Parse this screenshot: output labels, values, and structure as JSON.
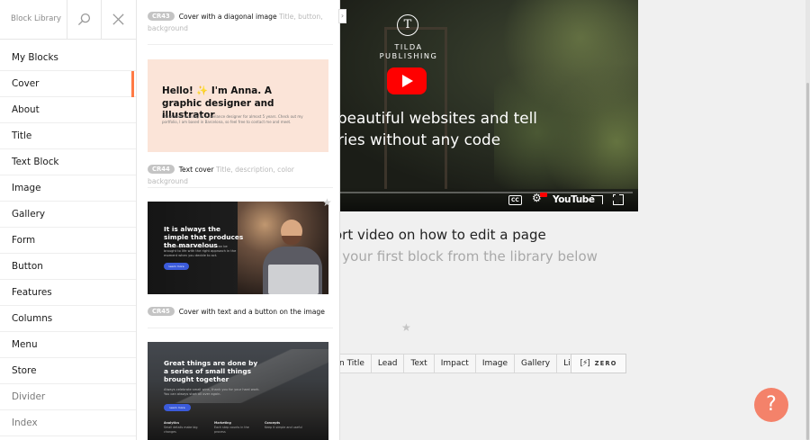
{
  "sidebar": {
    "title": "Block Library",
    "items": [
      {
        "label": "My Blocks"
      },
      {
        "label": "Cover"
      },
      {
        "label": "About"
      },
      {
        "label": "Title"
      },
      {
        "label": "Text Block"
      },
      {
        "label": "Image"
      },
      {
        "label": "Gallery"
      },
      {
        "label": "Form"
      },
      {
        "label": "Button"
      },
      {
        "label": "Features"
      },
      {
        "label": "Columns"
      },
      {
        "label": "Menu"
      },
      {
        "label": "Store"
      },
      {
        "label": "Divider"
      },
      {
        "label": "Index"
      }
    ],
    "active_item": "Cover",
    "accent_color": "#ff7a45"
  },
  "panel": {
    "blocks": [
      {
        "code": "CR43",
        "name": "Cover with a diagonal image",
        "meta": "Title, button, background"
      },
      {
        "code": "CR44",
        "name": "Text cover",
        "meta": "Title, description, color background"
      },
      {
        "code": "CR45",
        "name": "Cover with text and a button on the image",
        "meta": ""
      }
    ],
    "thumb1": {
      "heading": "Hello! ✨ I'm Anna. A graphic designer and illustrator",
      "text": "I have been working as a freelance designer for almost 5 years. Check out my portfolio, I am based in Barcelona, so feel free to contact me and meet."
    },
    "thumb2": {
      "heading": "It is always the simple that produces the marvelous",
      "text": "Everything that you dreamed of can be brought to life with the right approach in the moment when you decide to act.",
      "button": "Learn more"
    },
    "thumb3": {
      "heading": "Great things are done by a series of small things brought together",
      "text": "Always celebrate small wins, thank you for your hard work. You can always start all over again.",
      "button": "Learn more",
      "columns": [
        {
          "title": "Analytics",
          "text": "Small details make big changes"
        },
        {
          "title": "Marketing",
          "text": "Each step counts in the process"
        },
        {
          "title": "Concepts",
          "text": "Keep it simple and useful"
        }
      ]
    }
  },
  "video": {
    "logo_letter": "T",
    "brand": "TILDA PUBLISHING",
    "caption": "beautiful websites and tell\nries without any code",
    "controls": {
      "cc": "CC",
      "youtube": "YouTube"
    }
  },
  "hints": {
    "line1": "ort video on how to edit a page",
    "line2": "g your first block from the library below"
  },
  "quick_blocks": [
    "n Title",
    "Lead",
    "Text",
    "Impact",
    "Image",
    "Gallery",
    "Line"
  ],
  "zero_block": {
    "icon": "[⚡]",
    "label": "ZERO"
  },
  "help": {
    "label": "?",
    "color": "#f4826a"
  }
}
